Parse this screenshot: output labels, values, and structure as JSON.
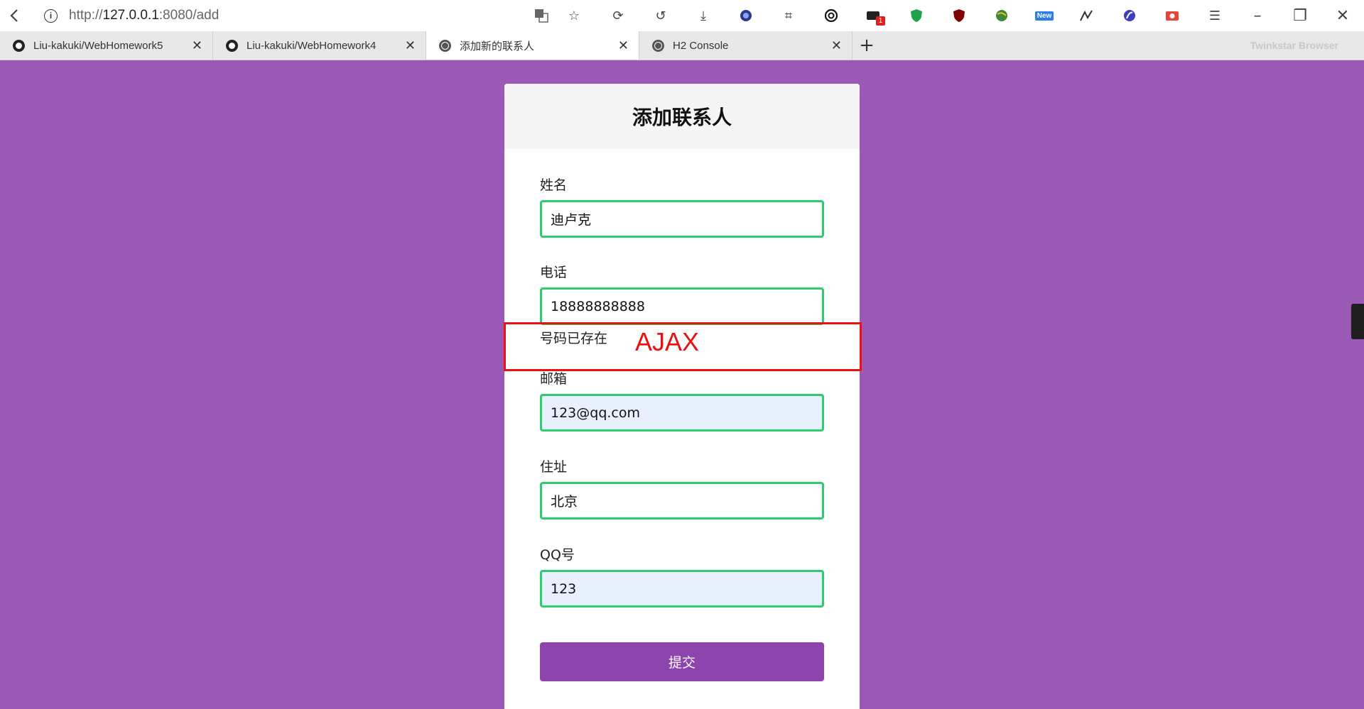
{
  "browser": {
    "url_prefix": "http://",
    "url_host": "127.0.0.1",
    "url_rest": ":8080/add",
    "brand": "Twinkstar Browser",
    "badge_new": "New",
    "badge_count": "1",
    "tabs": [
      {
        "label": "Liu-kakuki/WebHomework5",
        "favicon": "github"
      },
      {
        "label": "Liu-kakuki/WebHomework4",
        "favicon": "github"
      },
      {
        "label": "添加新的联系人",
        "favicon": "globe"
      },
      {
        "label": "H2 Console",
        "favicon": "globe"
      }
    ],
    "new_tab": "+"
  },
  "form": {
    "title": "添加联系人",
    "name_label": "姓名",
    "name_value": "迪卢克",
    "phone_label": "电话",
    "phone_value": "18888888888",
    "phone_message": "号码已存在",
    "email_label": "邮箱",
    "email_value": "123@qq.com",
    "address_label": "住址",
    "address_value": "北京",
    "qq_label": "QQ号",
    "qq_value": "123",
    "submit_label": "提交"
  },
  "annotation": {
    "text": "AJAX",
    "color": "#e81212"
  },
  "colors": {
    "background": "#9b59b6",
    "input_border": "#2ecc71",
    "button": "#8e44ad"
  }
}
